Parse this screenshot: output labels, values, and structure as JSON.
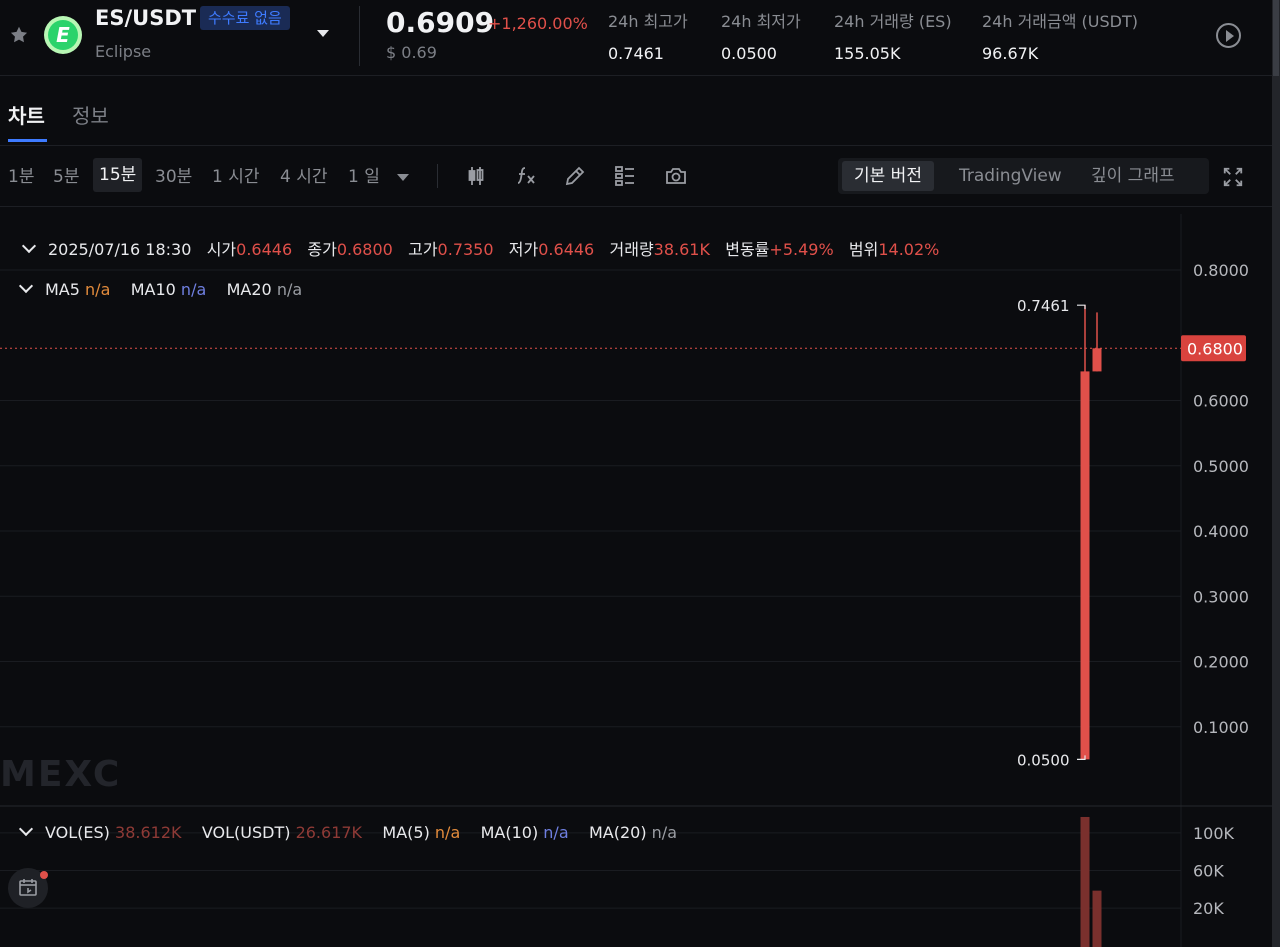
{
  "header": {
    "pair": "ES/USDT",
    "fee_badge": "수수료 없음",
    "project_name": "Eclipse",
    "logo_letter": "E",
    "last_price": "0.6909",
    "change_pct": "+1,260.00%",
    "usd_price": "$ 0.69",
    "stats": [
      {
        "label": "24h 최고가",
        "value": "0.7461"
      },
      {
        "label": "24h 최저가",
        "value": "0.0500"
      },
      {
        "label": "24h 거래량 (ES)",
        "value": "155.05K"
      },
      {
        "label": "24h 거래금액 (USDT)",
        "value": "96.67K"
      }
    ],
    "icons": {
      "favorite": "star-icon",
      "play": "play-circle-icon"
    }
  },
  "tabs": [
    {
      "label": "차트",
      "active": true
    },
    {
      "label": "정보",
      "active": false
    }
  ],
  "toolbar": {
    "timeframes": [
      {
        "label": "1분",
        "active": false
      },
      {
        "label": "5분",
        "active": false
      },
      {
        "label": "15분",
        "active": true
      },
      {
        "label": "30분",
        "active": false
      },
      {
        "label": "1 시간",
        "active": false
      },
      {
        "label": "4 시간",
        "active": false
      },
      {
        "label": "1 일",
        "active": false
      }
    ],
    "tools": [
      "candlestick-icon",
      "indicator-fx-icon",
      "pencil-icon",
      "layout-grid-icon",
      "camera-icon"
    ],
    "views": [
      {
        "label": "기본 버전",
        "active": true
      },
      {
        "label": "TradingView",
        "active": false
      },
      {
        "label": "깊이 그래프",
        "active": false
      }
    ]
  },
  "ohlc": {
    "datetime": "2025/07/16 18:30",
    "open_label": "시가",
    "open": "0.6446",
    "close_label": "종가",
    "close": "0.6800",
    "high_label": "고가",
    "high": "0.7350",
    "low_label": "저가",
    "low": "0.6446",
    "volume_label": "거래량",
    "volume": "38.61K",
    "change_label": "변동률",
    "change": "+5.49%",
    "range_label": "범위",
    "range": "14.02%"
  },
  "ma_line": {
    "ma5_label": "MA5",
    "ma5": "n/a",
    "ma10_label": "MA10",
    "ma10": "n/a",
    "ma20_label": "MA20",
    "ma20": "n/a"
  },
  "vol_line": {
    "vol_es_label": "VOL(ES)",
    "vol_es": "38.612K",
    "vol_usdt_label": "VOL(USDT)",
    "vol_usdt": "26.617K",
    "ma5_label": "MA(5)",
    "ma5": "n/a",
    "ma10_label": "MA(10)",
    "ma10": "n/a",
    "ma20_label": "MA(20)",
    "ma20": "n/a"
  },
  "watermark": "MEXC",
  "chart_data": {
    "type": "candlestick",
    "y_ticks": [
      "0.8000",
      "0.6000",
      "0.5000",
      "0.4000",
      "0.3000",
      "0.2000",
      "0.1000"
    ],
    "ylim": [
      0.0,
      0.8
    ],
    "current_price_tag": "0.6800",
    "high_marker": "0.7461",
    "low_marker": "0.0500",
    "candles": [
      {
        "open": 0.05,
        "close": 0.6446,
        "high": 0.7461,
        "low": 0.05
      },
      {
        "open": 0.6446,
        "close": 0.68,
        "high": 0.735,
        "low": 0.6446
      }
    ],
    "volume_ticks": [
      "100K",
      "60K",
      "20K"
    ],
    "volume_ylim": [
      0,
      120000
    ],
    "volumes": [
      116840,
      38612
    ],
    "colors": {
      "up": "#e0504a",
      "volume": "#7a302d",
      "background": "#0b0c0f",
      "grid": "#1a1c21"
    }
  }
}
